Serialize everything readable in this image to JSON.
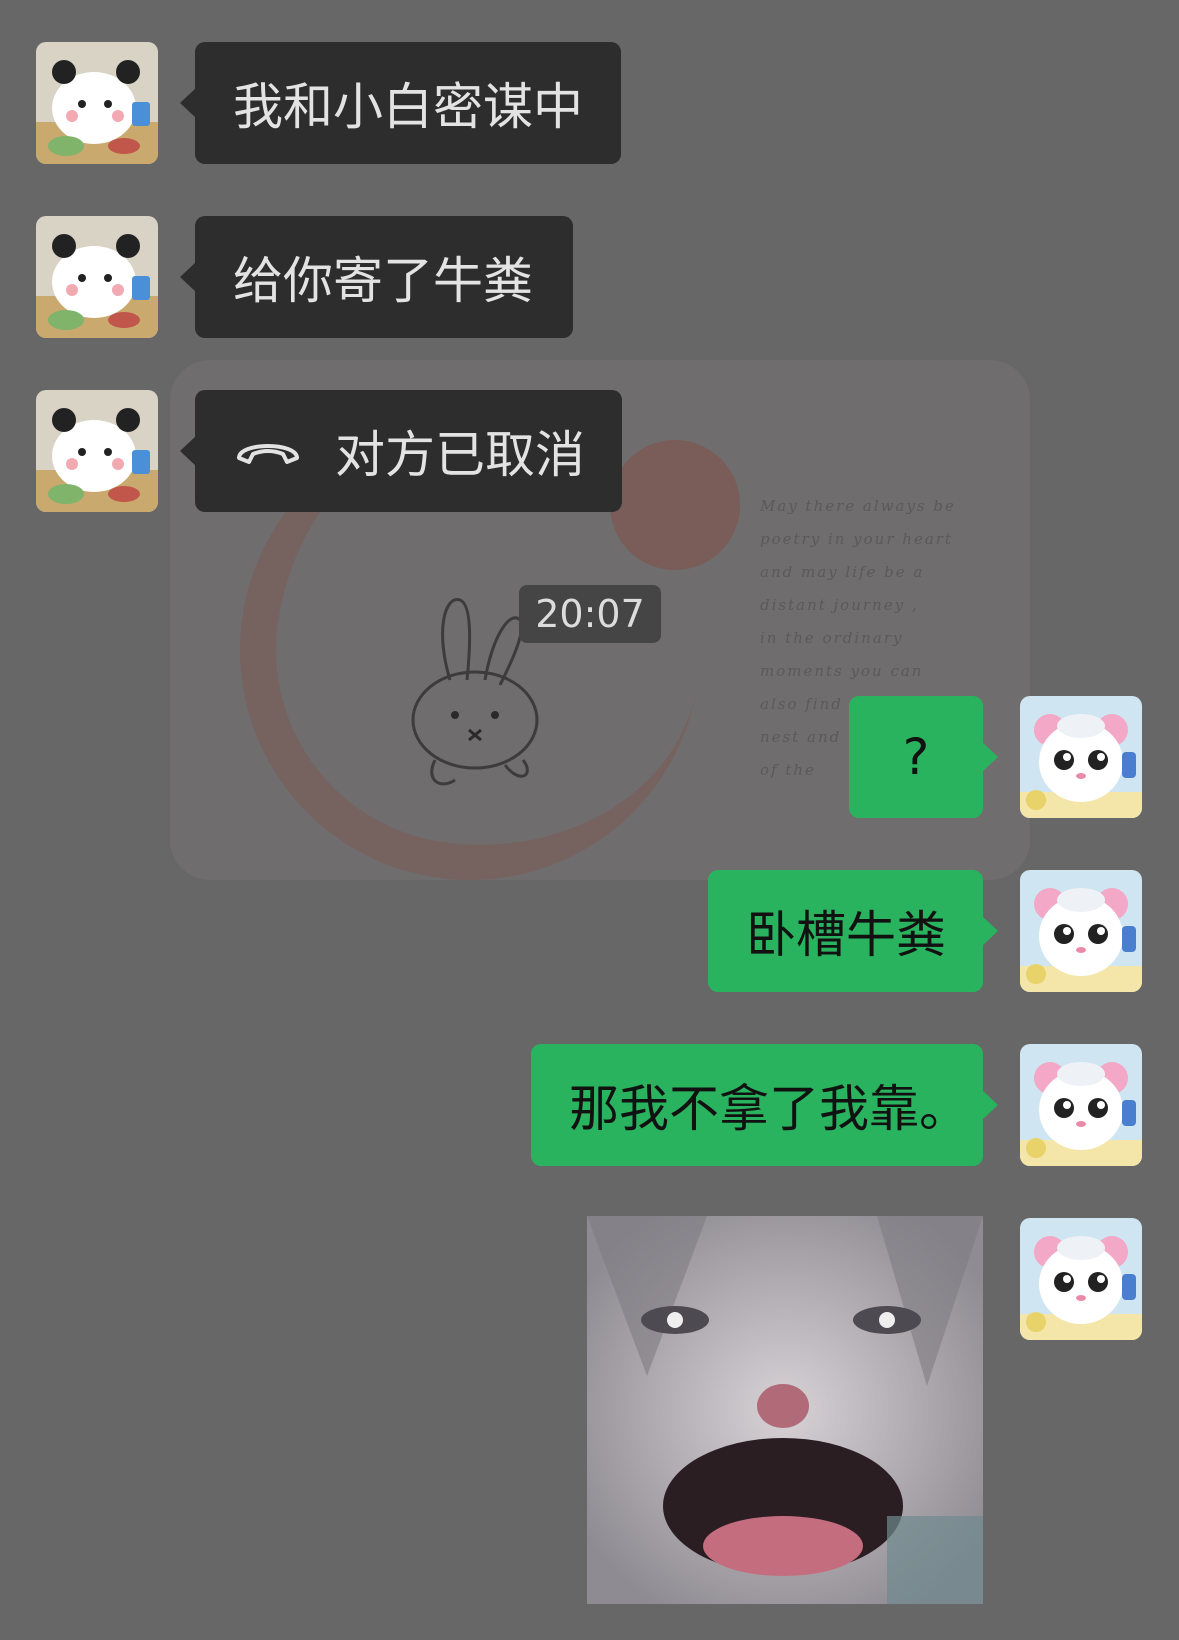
{
  "chat": {
    "timestamp": "20:07",
    "messages": [
      {
        "side": "incoming",
        "text": "我和小白密谋中",
        "avatar": "panda-avatar-icon"
      },
      {
        "side": "incoming",
        "text": "给你寄了牛粪",
        "avatar": "panda-avatar-icon"
      },
      {
        "side": "incoming",
        "text": "对方已取消",
        "icon": "phone-hangup-icon",
        "avatar": "panda-avatar-icon"
      },
      {
        "side": "outgoing",
        "text": "?",
        "avatar": "hamster-avatar-icon"
      },
      {
        "side": "outgoing",
        "text": "卧槽牛粪",
        "avatar": "hamster-avatar-icon"
      },
      {
        "side": "outgoing",
        "text": "那我不拿了我靠。",
        "avatar": "hamster-avatar-icon"
      },
      {
        "side": "outgoing",
        "type": "image",
        "description_icon": "screaming-cat-image",
        "avatar": "hamster-avatar-icon"
      }
    ]
  },
  "wallpaper": {
    "lines": [
      "May there always be",
      "poetry in your heart",
      "and may life be a",
      "distant journey ,",
      "in the ordinary",
      "moments you can",
      "also find",
      "nest and",
      "of the"
    ]
  },
  "colors": {
    "background": "#676767",
    "incoming_bubble": "#2d2d2d",
    "outgoing_bubble": "#29b35f"
  }
}
